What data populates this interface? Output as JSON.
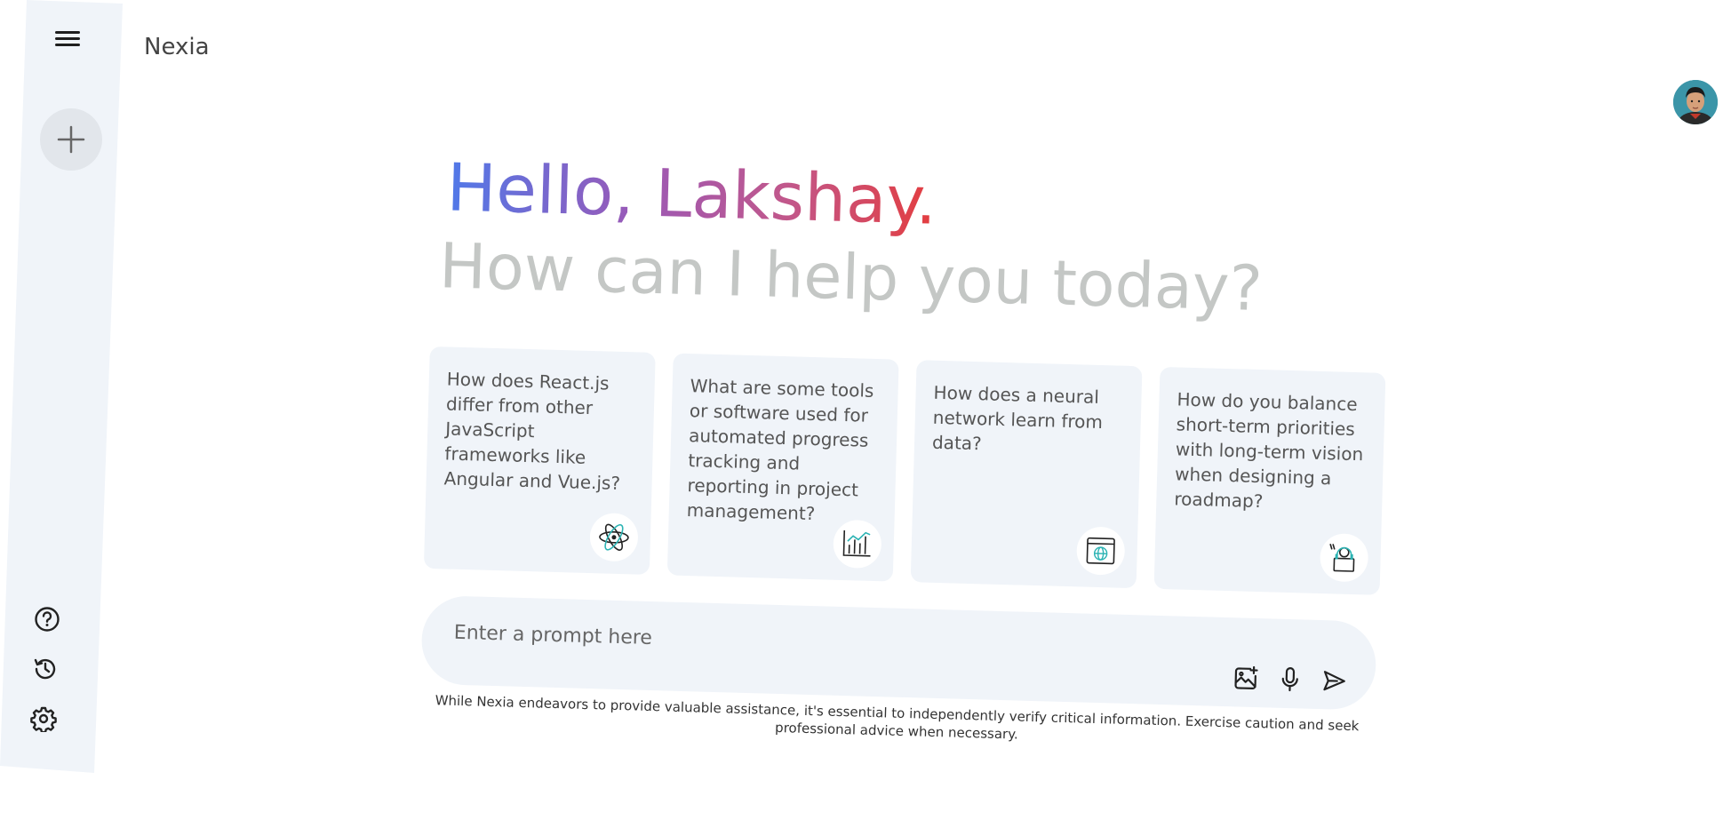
{
  "app": {
    "brand": "Nexia"
  },
  "greeting": {
    "hello": "Hello, Lakshay.",
    "subtitle": "How can I help you today?"
  },
  "cards": [
    {
      "text": "How does React.js differ from other JavaScript frameworks like Angular and Vue.js?",
      "icon": "atom-icon"
    },
    {
      "text": "What are some tools or software used for automated progress tracking and reporting in project management?",
      "icon": "chart-icon"
    },
    {
      "text": "How does a neural network learn from data?",
      "icon": "globe-window-icon"
    },
    {
      "text": "How do you balance short-term priorities with long-term vision when designing a roadmap?",
      "icon": "headset-user-icon"
    }
  ],
  "prompt": {
    "placeholder": "Enter a prompt here"
  },
  "disclaimer": "While Nexia endeavors to provide valuable assistance, it's essential to independently verify critical information. Exercise caution and seek professional advice when necessary.",
  "sidebar": {
    "icons": [
      "menu-icon",
      "plus-icon",
      "help-icon",
      "history-icon",
      "settings-icon"
    ]
  },
  "colors": {
    "panel": "#f0f4f9",
    "greeting_gradient_start": "#4b7bec",
    "greeting_gradient_end": "#e53c3c",
    "subtitle": "#c4c7c5"
  }
}
